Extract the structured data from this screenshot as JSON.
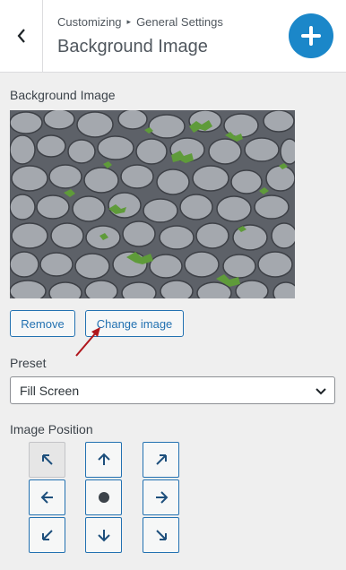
{
  "header": {
    "breadcrumb_root": "Customizing",
    "breadcrumb_separator": "▸",
    "breadcrumb_current": "General Settings",
    "section_title": "Background Image",
    "back_icon": "chevron-left-icon",
    "add_icon": "plus-icon"
  },
  "background_image": {
    "label": "Background Image",
    "remove_label": "Remove",
    "change_label": "Change image"
  },
  "preset": {
    "label": "Preset",
    "selected": "Fill Screen"
  },
  "image_position": {
    "label": "Image Position",
    "selected": "top-left",
    "options": [
      {
        "id": "top-left",
        "icon": "arrow-up-left-icon"
      },
      {
        "id": "top",
        "icon": "arrow-up-icon"
      },
      {
        "id": "top-right",
        "icon": "arrow-up-right-icon"
      },
      {
        "id": "left",
        "icon": "arrow-left-icon"
      },
      {
        "id": "center",
        "icon": "dot-icon"
      },
      {
        "id": "right",
        "icon": "arrow-right-icon"
      },
      {
        "id": "bottom-left",
        "icon": "arrow-down-left-icon"
      },
      {
        "id": "bottom",
        "icon": "arrow-down-icon"
      },
      {
        "id": "bottom-right",
        "icon": "arrow-down-right-icon"
      }
    ]
  },
  "colors": {
    "accent": "#2271b1",
    "add_button": "#1b87c9",
    "annotation_arrow": "#b0161c"
  }
}
